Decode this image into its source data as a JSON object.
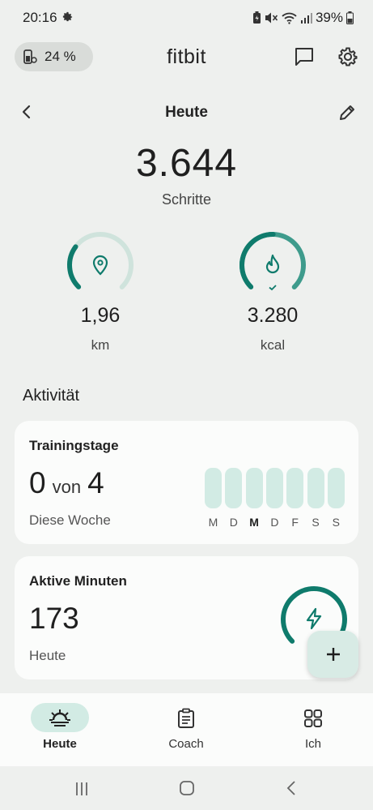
{
  "status_bar": {
    "time": "20:16",
    "battery": "39%",
    "icons": [
      "gear-icon",
      "battery-saver-icon",
      "mute-icon",
      "wifi-icon",
      "signal-icon",
      "battery-icon"
    ]
  },
  "header": {
    "device_battery": "24 %",
    "app_title": "fitbit",
    "icons": [
      "tracker-icon",
      "message-icon",
      "settings-icon"
    ]
  },
  "date_nav": {
    "title": "Heute",
    "icons": [
      "back-arrow-icon",
      "edit-pencil-icon"
    ]
  },
  "steps": {
    "value": "3.644",
    "label": "Schritte"
  },
  "rings": [
    {
      "value": "1,96",
      "unit": "km",
      "icon": "location-pin-icon",
      "progress": 0.3
    },
    {
      "value": "3.280",
      "unit": "kcal",
      "icon": "flame-icon",
      "progress": 1.0
    }
  ],
  "activity": {
    "section_title": "Aktivität",
    "training_days": {
      "title": "Trainingstage",
      "count": "0",
      "von": "von",
      "goal": "4",
      "period": "Diese Woche",
      "days": [
        "M",
        "D",
        "M",
        "D",
        "F",
        "S",
        "S"
      ],
      "today_index": 2
    },
    "active_minutes": {
      "title": "Aktive Minuten",
      "value": "173",
      "period": "Heute",
      "icon": "lightning-icon",
      "progress": 0.75
    }
  },
  "fab": {
    "icon": "plus-icon"
  },
  "bottom_nav": {
    "items": [
      {
        "label": "Heute",
        "icon": "sunrise-icon",
        "active": true
      },
      {
        "label": "Coach",
        "icon": "clipboard-icon",
        "active": false
      },
      {
        "label": "Ich",
        "icon": "grid-icon",
        "active": false
      }
    ]
  },
  "system_nav": {
    "icons": [
      "recents-icon",
      "home-icon",
      "back-icon"
    ]
  },
  "colors": {
    "accent": "#0f7b6c",
    "ring_track": "#cfe3dc",
    "pill": "#d2ebe4"
  }
}
